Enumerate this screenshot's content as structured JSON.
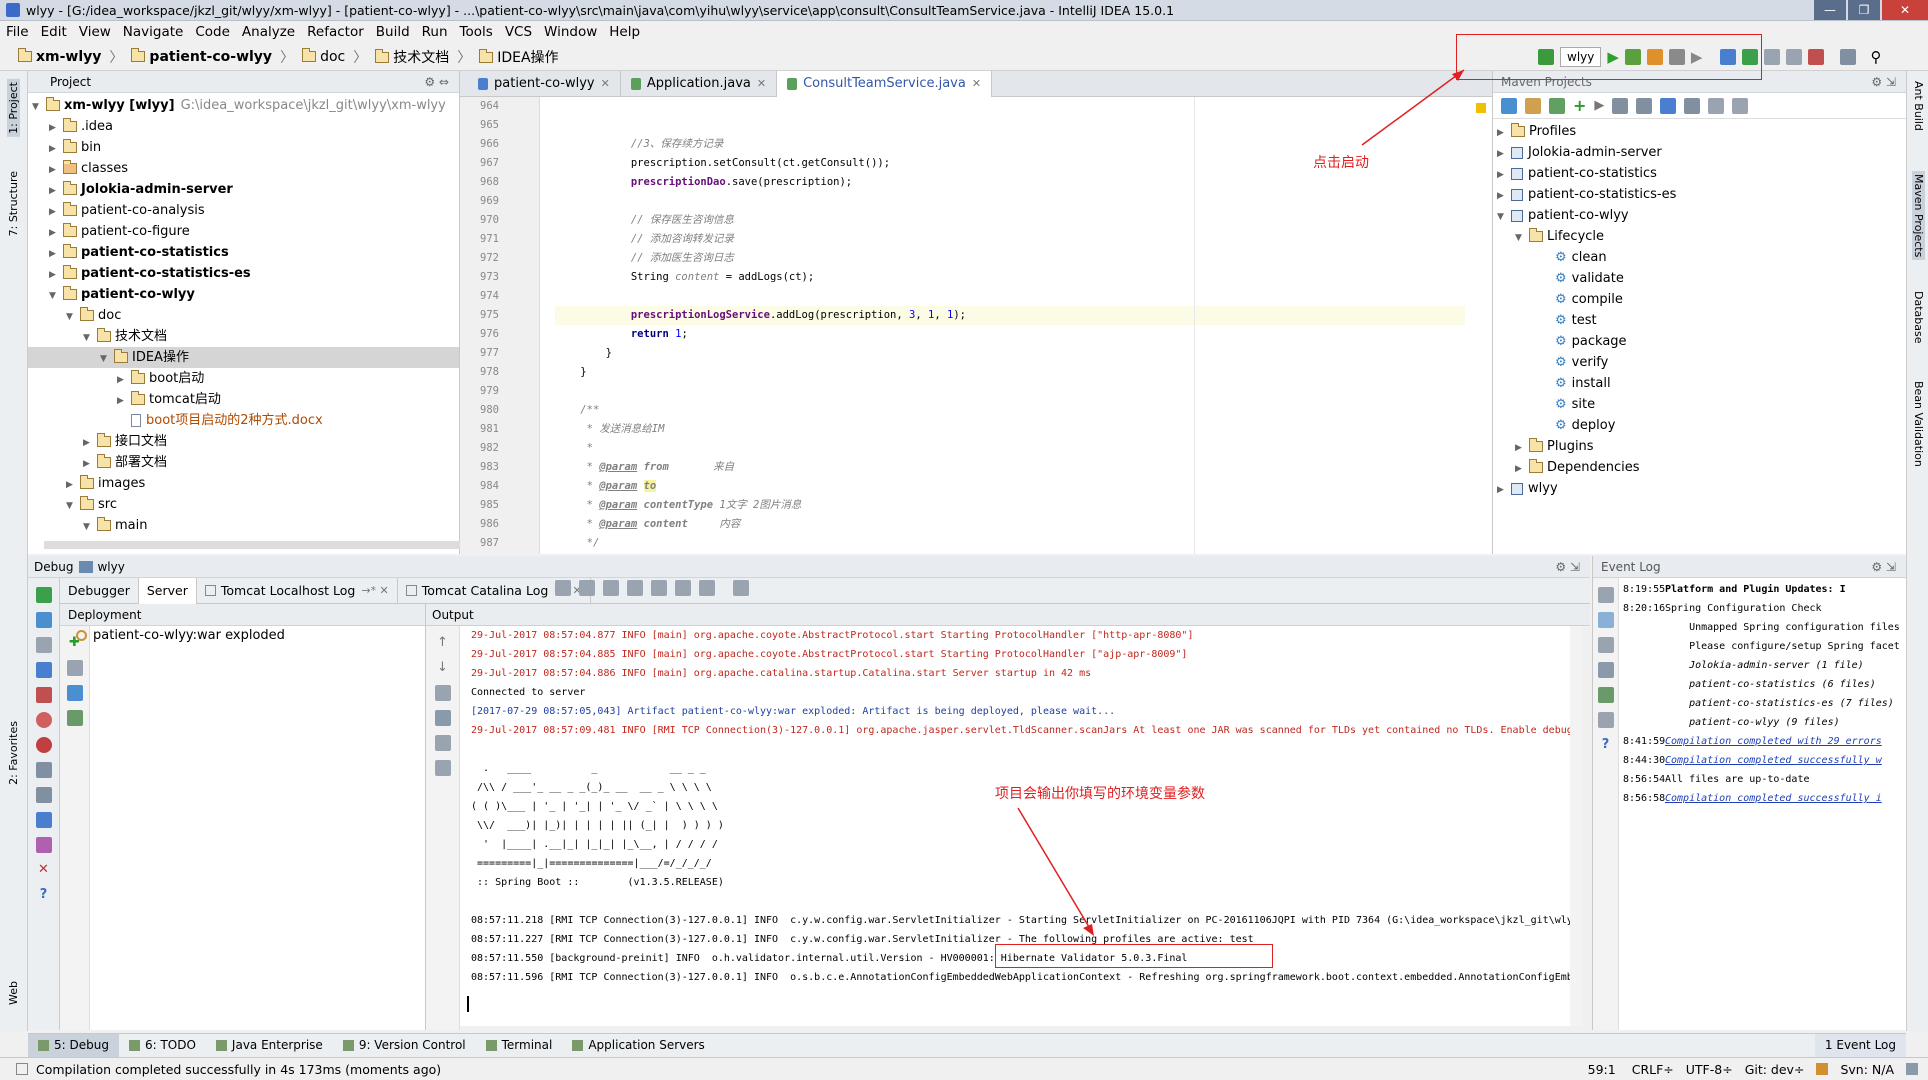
{
  "window": {
    "title": "wlyy - [G:/idea_workspace/jkzl_git/wlyy/xm-wlyy] - [patient-co-wlyy] - ...\\patient-co-wlyy\\src\\main\\java\\com\\yihu\\wlyy\\service\\app\\consult\\ConsultTeamService.java - IntelliJ IDEA 15.0.1"
  },
  "menu": [
    "File",
    "Edit",
    "View",
    "Navigate",
    "Code",
    "Analyze",
    "Refactor",
    "Build",
    "Run",
    "Tools",
    "VCS",
    "Window",
    "Help"
  ],
  "breadcrumb": [
    "xm-wlyy",
    "patient-co-wlyy",
    "doc",
    "技术文档",
    "IDEA操作"
  ],
  "toolbar": {
    "run_config": "wlyy"
  },
  "project": {
    "title": "Project",
    "rows": [
      {
        "indent": 0,
        "arrow": "▼",
        "label": "xm-wlyy [wlyy]",
        "path": "G:\\idea_workspace\\jkzl_git\\wlyy\\xm-wlyy",
        "bold": false
      },
      {
        "indent": 1,
        "arrow": "▶",
        "label": ".idea"
      },
      {
        "indent": 1,
        "arrow": "▶",
        "label": "bin"
      },
      {
        "indent": 1,
        "arrow": "▶",
        "label": "classes",
        "folder": "brown"
      },
      {
        "indent": 1,
        "arrow": "▶",
        "label": "Jolokia-admin-server",
        "bold": true
      },
      {
        "indent": 1,
        "arrow": "▶",
        "label": "patient-co-analysis"
      },
      {
        "indent": 1,
        "arrow": "▶",
        "label": "patient-co-figure"
      },
      {
        "indent": 1,
        "arrow": "▶",
        "label": "patient-co-statistics",
        "bold": true
      },
      {
        "indent": 1,
        "arrow": "▶",
        "label": "patient-co-statistics-es",
        "bold": true
      },
      {
        "indent": 1,
        "arrow": "▼",
        "label": "patient-co-wlyy",
        "bold": true
      },
      {
        "indent": 2,
        "arrow": "▼",
        "label": "doc"
      },
      {
        "indent": 3,
        "arrow": "▼",
        "label": "技术文档"
      },
      {
        "indent": 4,
        "arrow": "▼",
        "label": "IDEA操作",
        "selected": true
      },
      {
        "indent": 5,
        "arrow": "▶",
        "label": "boot启动"
      },
      {
        "indent": 5,
        "arrow": "▶",
        "label": "tomcat启动"
      },
      {
        "indent": 5,
        "arrow": "",
        "label": "boot项目启动的2种方式.docx",
        "file": true
      },
      {
        "indent": 3,
        "arrow": "▶",
        "label": "接口文档"
      },
      {
        "indent": 3,
        "arrow": "▶",
        "label": "部署文档"
      },
      {
        "indent": 2,
        "arrow": "▶",
        "label": "images"
      },
      {
        "indent": 2,
        "arrow": "▼",
        "label": "src"
      },
      {
        "indent": 3,
        "arrow": "▼",
        "label": "main"
      }
    ]
  },
  "editor": {
    "tabs": [
      {
        "label": "patient-co-wlyy",
        "active": false
      },
      {
        "label": "Application.java",
        "active": false
      },
      {
        "label": "ConsultTeamService.java",
        "active": true
      }
    ],
    "lines": [
      {
        "n": "964",
        "html": ""
      },
      {
        "n": "965",
        "html": ""
      },
      {
        "n": "966",
        "html": "            <span class=\"cmt\">//3、保存续方记录</span>"
      },
      {
        "n": "967",
        "html": "            prescription.setConsult(ct.getConsult());"
      },
      {
        "n": "968",
        "html": "            <span class=\"fld\">prescriptionDao</span>.save(prescription);"
      },
      {
        "n": "969",
        "html": ""
      },
      {
        "n": "970",
        "html": "            <span class=\"cmt\">// 保存医生咨询信息</span>"
      },
      {
        "n": "971",
        "html": "            <span class=\"cmt\">// 添加咨询转发记录</span>"
      },
      {
        "n": "972",
        "html": "            <span class=\"cmt\">// 添加医生咨询日志</span>"
      },
      {
        "n": "973",
        "html": "            String <span class=\"cmt\">content</span> = addLogs(ct);"
      },
      {
        "n": "974",
        "html": ""
      },
      {
        "n": "975",
        "html": "            <span class=\"fld\">prescriptionLogService</span>.addLog(prescription, <span class=\"num\">3</span>, <span class=\"num\">1</span>, <span class=\"num\">1</span>);",
        "hl": true
      },
      {
        "n": "976",
        "html": "            <span class=\"kw\">return</span> <span class=\"num\">1</span>;"
      },
      {
        "n": "977",
        "html": "        }"
      },
      {
        "n": "978",
        "html": "    }"
      },
      {
        "n": "979",
        "html": ""
      },
      {
        "n": "980",
        "html": "    <span class=\"cmt\">/**</span>"
      },
      {
        "n": "981",
        "html": "    <span class=\"cmt\"> * 发送消息给IM</span>"
      },
      {
        "n": "982",
        "html": "    <span class=\"cmt\"> *</span>"
      },
      {
        "n": "983",
        "html": "    <span class=\"cmt\"> * </span><span class=\"tag\">@param</span> <span class=\"cmt\"><b>from</b>       来自</span>"
      },
      {
        "n": "984",
        "html": "    <span class=\"cmt\"> * </span><span class=\"tag\">@param</span> <span class=\"cmt\"><b style=\"background:#f6f2a0\">to</b></span>"
      },
      {
        "n": "985",
        "html": "    <span class=\"cmt\"> * </span><span class=\"tag\">@param</span> <span class=\"cmt\"><b>contentType</b> 1文字 2图片消息</span>"
      },
      {
        "n": "986",
        "html": "    <span class=\"cmt\"> * </span><span class=\"tag\">@param</span> <span class=\"cmt\"><b>content</b>     内容</span>"
      },
      {
        "n": "987",
        "html": "    <span class=\"cmt\"> */</span>"
      }
    ]
  },
  "maven": {
    "title": "Maven Projects",
    "rows": [
      {
        "indent": 0,
        "arrow": "▶",
        "label": "Profiles",
        "icon": "folder"
      },
      {
        "indent": 0,
        "arrow": "▶",
        "label": "Jolokia-admin-server",
        "icon": "module"
      },
      {
        "indent": 0,
        "arrow": "▶",
        "label": "patient-co-statistics",
        "icon": "module"
      },
      {
        "indent": 0,
        "arrow": "▶",
        "label": "patient-co-statistics-es",
        "icon": "module"
      },
      {
        "indent": 0,
        "arrow": "▼",
        "label": "patient-co-wlyy",
        "icon": "module"
      },
      {
        "indent": 1,
        "arrow": "▼",
        "label": "Lifecycle",
        "icon": "folder"
      },
      {
        "indent": 2,
        "arrow": "",
        "label": "clean",
        "icon": "gear"
      },
      {
        "indent": 2,
        "arrow": "",
        "label": "validate",
        "icon": "gear"
      },
      {
        "indent": 2,
        "arrow": "",
        "label": "compile",
        "icon": "gear"
      },
      {
        "indent": 2,
        "arrow": "",
        "label": "test",
        "icon": "gear"
      },
      {
        "indent": 2,
        "arrow": "",
        "label": "package",
        "icon": "gear"
      },
      {
        "indent": 2,
        "arrow": "",
        "label": "verify",
        "icon": "gear"
      },
      {
        "indent": 2,
        "arrow": "",
        "label": "install",
        "icon": "gear"
      },
      {
        "indent": 2,
        "arrow": "",
        "label": "site",
        "icon": "gear"
      },
      {
        "indent": 2,
        "arrow": "",
        "label": "deploy",
        "icon": "gear"
      },
      {
        "indent": 1,
        "arrow": "▶",
        "label": "Plugins",
        "icon": "folder"
      },
      {
        "indent": 1,
        "arrow": "▶",
        "label": "Dependencies",
        "icon": "folder"
      },
      {
        "indent": 0,
        "arrow": "▶",
        "label": "wlyy",
        "icon": "module"
      }
    ]
  },
  "debug": {
    "title": "Debug",
    "config": "wlyy",
    "tabs": [
      {
        "label": "Debugger",
        "active": false
      },
      {
        "label": "Server",
        "active": true
      },
      {
        "label": "Tomcat Localhost Log",
        "active": false
      },
      {
        "label": "Tomcat Catalina Log",
        "active": false
      }
    ],
    "deployment_title": "Deployment",
    "artifact": "patient-co-wlyy:war exploded",
    "output_title": "Output",
    "lines": [
      {
        "t": "29-Jul-2017 08:57:04.877 INFO [main] org.apache.coyote.AbstractProtocol.start Starting ProtocolHandler [\"http-apr-8080\"]",
        "c": "red"
      },
      {
        "t": "29-Jul-2017 08:57:04.885 INFO [main] org.apache.coyote.AbstractProtocol.start Starting ProtocolHandler [\"ajp-apr-8009\"]",
        "c": "red"
      },
      {
        "t": "29-Jul-2017 08:57:04.886 INFO [main] org.apache.catalina.startup.Catalina.start Server startup in 42 ms",
        "c": "red"
      },
      {
        "t": "Connected to server",
        "c": ""
      },
      {
        "t": "[2017-07-29 08:57:05,043] Artifact patient-co-wlyy:war exploded: Artifact is being deployed, please wait...",
        "c": "blue"
      },
      {
        "t": "29-Jul-2017 08:57:09.481 INFO [RMI TCP Connection(3)-127.0.0.1] org.apache.jasper.servlet.TldScanner.scanJars At least one JAR was scanned for TLDs yet contained no TLDs. Enable debug",
        "c": "red"
      },
      {
        "t": "",
        "c": ""
      },
      {
        "t": "  .   ____          _            __ _ _",
        "c": ""
      },
      {
        "t": " /\\\\ / ___'_ __ _ _(_)_ __  __ _ \\ \\ \\ \\",
        "c": ""
      },
      {
        "t": "( ( )\\___ | '_ | '_| | '_ \\/ _` | \\ \\ \\ \\",
        "c": ""
      },
      {
        "t": " \\\\/  ___)| |_)| | | | | || (_| |  ) ) ) )",
        "c": ""
      },
      {
        "t": "  '  |____| .__|_| |_|_| |_\\__, | / / / /",
        "c": ""
      },
      {
        "t": " =========|_|==============|___/=/_/_/_/",
        "c": ""
      },
      {
        "t": " :: Spring Boot ::        (v1.3.5.RELEASE)",
        "c": ""
      },
      {
        "t": "",
        "c": ""
      },
      {
        "t": "08:57:11.218 [RMI TCP Connection(3)-127.0.0.1] INFO  c.y.w.config.war.ServletInitializer - Starting ServletInitializer on PC-20161106JQPI with PID 7364 (G:\\idea_workspace\\jkzl_git\\wly",
        "c": ""
      },
      {
        "t": "08:57:11.227 [RMI TCP Connection(3)-127.0.0.1] INFO  c.y.w.config.war.ServletInitializer - The following profiles are active: test",
        "c": ""
      },
      {
        "t": "08:57:11.550 [background-preinit] INFO  o.h.validator.internal.util.Version - HV000001: Hibernate Validator 5.0.3.Final",
        "c": ""
      },
      {
        "t": "08:57:11.596 [RMI TCP Connection(3)-127.0.0.1] INFO  o.s.b.c.e.AnnotationConfigEmbeddedWebApplicationContext - Refreshing org.springframework.boot.context.embedded.AnnotationConfigEmb",
        "c": ""
      }
    ]
  },
  "eventlog": {
    "title": "Event Log",
    "entries": [
      {
        "time": "8:19:55",
        "html": "<b>Platform and Plugin Updates: I</b>"
      },
      {
        "time": "8:20:16",
        "html": "Spring Configuration Check"
      },
      {
        "time": "",
        "html": "    Unmapped Spring configuration files"
      },
      {
        "time": "",
        "html": "    Please configure/setup Spring facet"
      },
      {
        "time": "",
        "html": "    <span class=\"it\">Jolokia-admin-server (1 file)</span>"
      },
      {
        "time": "",
        "html": "    <span class=\"it\">patient-co-statistics (6 files)</span>"
      },
      {
        "time": "",
        "html": "    <span class=\"it\">patient-co-statistics-es (7 files)</span>"
      },
      {
        "time": "",
        "html": "    <span class=\"it\">patient-co-wlyy (9 files)</span>"
      },
      {
        "time": "8:41:59",
        "html": "<span class=\"lnk\">Compilation completed with 29 errors</span>"
      },
      {
        "time": "8:44:30",
        "html": "<span class=\"lnk\">Compilation completed successfully w</span>"
      },
      {
        "time": "8:56:54",
        "html": "All files are up-to-date"
      },
      {
        "time": "8:56:58",
        "html": "<span class=\"lnk\">Compilation completed successfully i</span>"
      }
    ]
  },
  "bottom_tabs": [
    {
      "label": "5: Debug",
      "active": true
    },
    {
      "label": "6: TODO"
    },
    {
      "label": "Java Enterprise"
    },
    {
      "label": "9: Version Control"
    },
    {
      "label": "Terminal"
    },
    {
      "label": "Application Servers"
    }
  ],
  "eventlog_tab": "1  Event Log",
  "status": {
    "message": "Compilation completed successfully in 4s 173ms (moments ago)",
    "position": "59:1",
    "line_sep": "CRLF÷",
    "encoding": "UTF-8÷",
    "git": "Git: dev÷",
    "svn": "Svn: N/A"
  },
  "annotations": {
    "run_hint": "点击启动",
    "output_hint": "项目会输出你填写的环境变量参数"
  },
  "side_tabs_left": [
    "1: Project",
    "7: Structure",
    "2: Favorites",
    "Web"
  ],
  "side_tabs_right": [
    "Ant Build",
    "Maven Projects",
    "Database",
    "Bean Validation"
  ]
}
